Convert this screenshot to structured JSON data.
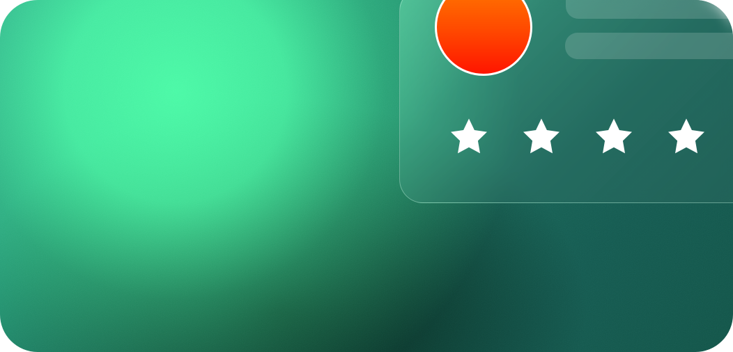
{
  "icons": {
    "avatar": "avatar-circle",
    "rating": [
      "star-icon",
      "star-icon",
      "star-icon",
      "star-icon"
    ]
  },
  "colors": {
    "background_primary": "#1a6b5a",
    "background_glow": "#4cffa8",
    "background_shadow": "#062218",
    "panel_tint": "#5cb79e",
    "avatar_top": "#ff7b00",
    "avatar_bottom": "#ff1500",
    "star": "#ffffff"
  },
  "rating": {
    "stars_visible": 4
  }
}
